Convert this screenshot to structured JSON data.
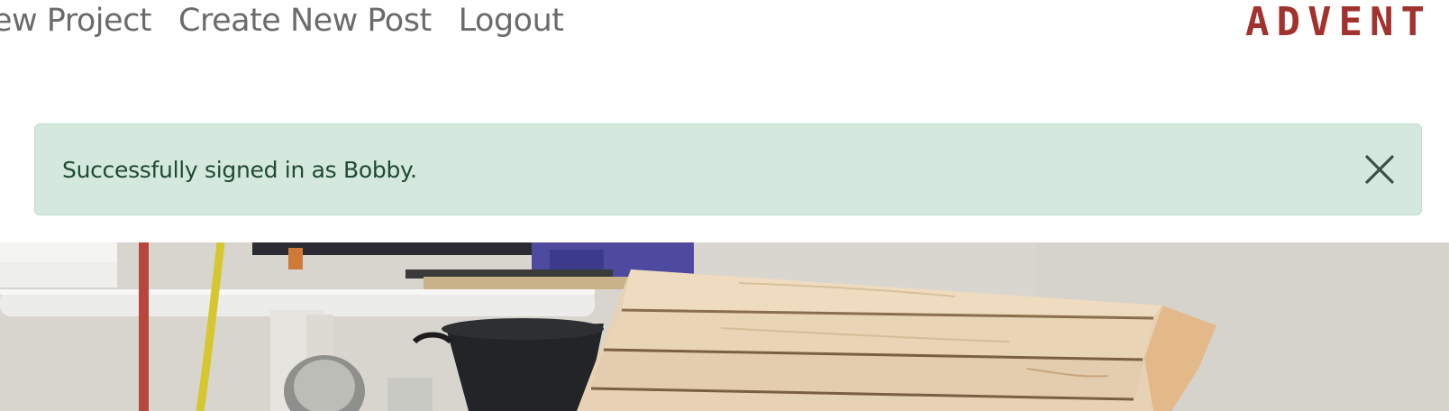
{
  "nav": {
    "links": [
      {
        "label": "ew Project"
      },
      {
        "label": "Create New Post"
      },
      {
        "label": "Logout"
      }
    ],
    "brand_text": "ADVENT"
  },
  "alert": {
    "message": "Successfully signed in as Bobby.",
    "close_icon": "close-icon"
  },
  "hero": {
    "image": "workshop-wood-planks-photo"
  },
  "colors": {
    "nav_link": "#6b6b6b",
    "brand": "#a2322e",
    "alert_bg": "#d4e8dd",
    "alert_text": "#1f4a33"
  }
}
